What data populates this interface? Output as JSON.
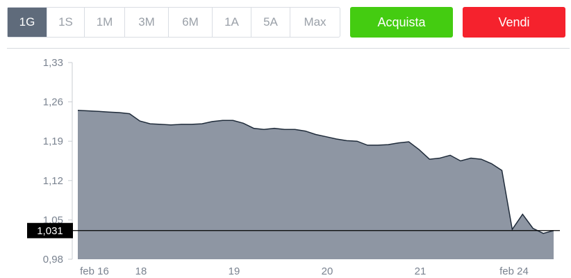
{
  "range_tabs": [
    {
      "label": "1G",
      "active": true
    },
    {
      "label": "1S",
      "active": false
    },
    {
      "label": "1M",
      "active": false
    },
    {
      "label": "3M",
      "active": false
    },
    {
      "label": "6M",
      "active": false
    },
    {
      "label": "1A",
      "active": false
    },
    {
      "label": "5A",
      "active": false
    },
    {
      "label": "Max",
      "active": false
    }
  ],
  "actions": {
    "buy_label": "Acquista",
    "sell_label": "Vendi"
  },
  "colors": {
    "buy": "#44cc11",
    "sell": "#f5222d",
    "area_fill": "#8e96a3",
    "line": "#1f2b3a",
    "active_tab": "#5f6b7b"
  },
  "current_price": "1,031",
  "chart_data": {
    "type": "area",
    "x_tick_labels": [
      "feb 16",
      "18",
      "19",
      "20",
      "21",
      "feb 24"
    ],
    "y_tick_labels": [
      "1,33",
      "1,26",
      "1,19",
      "1,12",
      "1,05",
      "0,98"
    ],
    "ylim": [
      0.98,
      1.33
    ],
    "current_value": 1.031,
    "values": [
      1.245,
      1.244,
      1.243,
      1.242,
      1.241,
      1.239,
      1.226,
      1.221,
      1.22,
      1.219,
      1.22,
      1.22,
      1.221,
      1.225,
      1.227,
      1.227,
      1.222,
      1.213,
      1.211,
      1.213,
      1.211,
      1.211,
      1.208,
      1.202,
      1.198,
      1.194,
      1.191,
      1.19,
      1.183,
      1.183,
      1.184,
      1.187,
      1.189,
      1.175,
      1.158,
      1.16,
      1.165,
      1.155,
      1.16,
      1.158,
      1.15,
      1.138,
      1.033,
      1.06,
      1.035,
      1.026,
      1.031
    ]
  }
}
